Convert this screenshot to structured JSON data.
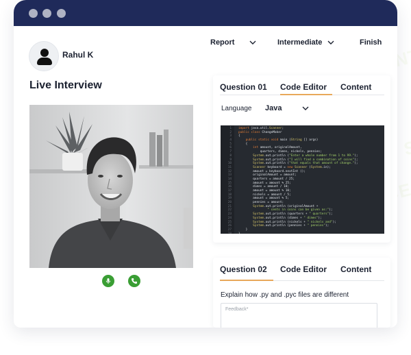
{
  "watermark": "AI TALENT SPACE",
  "colors": {
    "titlebar": "#1f2a5a",
    "accent_underline": "#e8a85a",
    "call_green": "#3a9e34",
    "code_bg": "#262a30"
  },
  "user": {
    "name": "Rahul K",
    "avatar_icon": "user-icon"
  },
  "interview": {
    "title": "Live Interview"
  },
  "toolbar": {
    "report_label": "Report",
    "level_label": "Intermediate",
    "finish_label": "Finish"
  },
  "call_controls": {
    "mic_icon": "microphone-icon",
    "phone_icon": "phone-icon"
  },
  "question1": {
    "tabs": [
      "Question 01",
      "Code Editor",
      "Content"
    ],
    "language_label": "Language",
    "language_value": "Java",
    "code_lines": [
      "import java.util.Scanner;",
      "public class ChangeMaker",
      "{",
      "    public static void main (String [] args)",
      "    {",
      "        int amount, originalAmount,",
      "            quarters, dimes, nickels, pennies;",
      "        System.out.println (\"Enter a whole number from 1 to 99.\");",
      "        System.out.println (\"I will find a combination of coins\");",
      "        System.out.println (\"that equals that amount of change.\");",
      "        Scanner keyboard = new Scanner (System.in);",
      "        amount = keyboard.nextInt ();",
      "        originalAmount = amount;",
      "        quarters = amount / 25;",
      "        amount = amount % 25;",
      "        dimes = amount / 10;",
      "        amount = amount % 10;",
      "        nickels = amount / 5;",
      "        amount = amount % 5;",
      "        pennies = amount;",
      "        System.out.println (originalAmount +",
      "                \" cents in coins can be given as:\");",
      "        System.out.println (quarters + \" quarters\");",
      "        System.out.println (dimes + \" dimes\");",
      "        System.out.println (nickels + \" nickels and\");",
      "        System.out.println (pennies + \" pennies\");",
      "    }",
      "}"
    ]
  },
  "question2": {
    "tabs": [
      "Question 02",
      "Code Editor",
      "Content"
    ],
    "prompt": "Explain how .py and .pyc files are different",
    "feedback_placeholder": "Feedback*"
  }
}
